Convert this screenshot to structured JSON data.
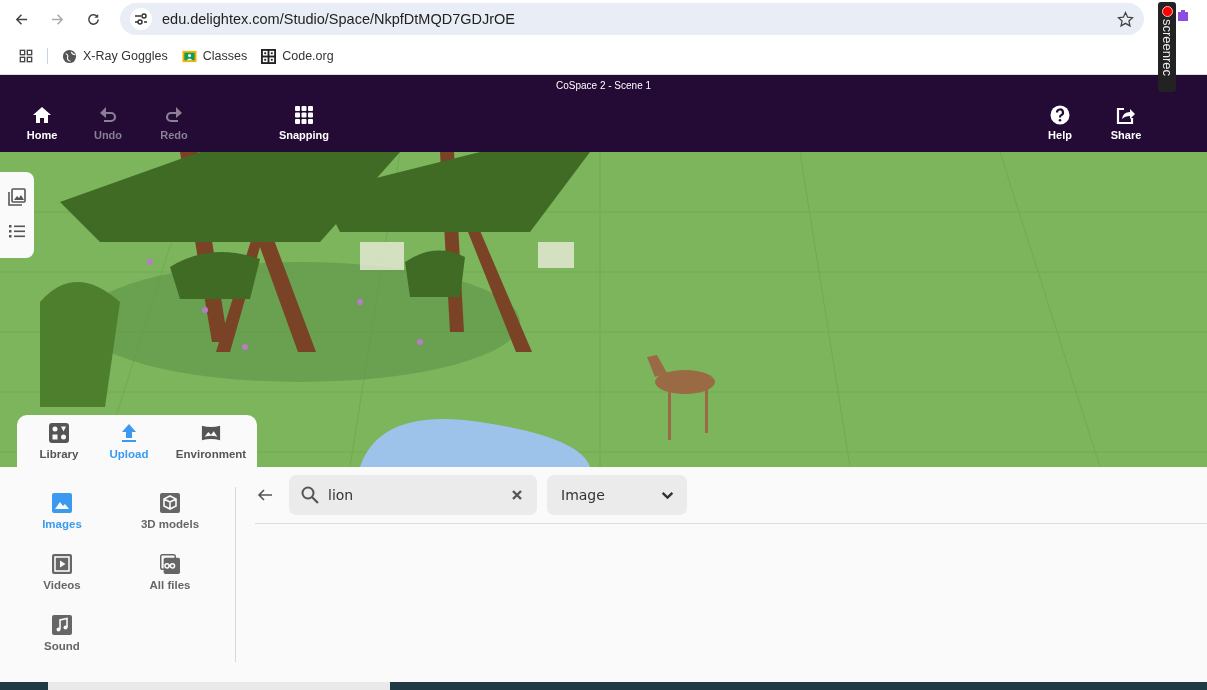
{
  "browser": {
    "url": "edu.delightex.com/Studio/Space/NkpfDtMQD7GDJrOE",
    "bookmarks": [
      {
        "label": "X-Ray Goggles",
        "kind": "globe"
      },
      {
        "label": "Classes",
        "kind": "classroom"
      },
      {
        "label": "Code.org",
        "kind": "code"
      }
    ],
    "recorder": {
      "label": "screenrec"
    }
  },
  "app": {
    "title": "CoSpace 2 - Scene 1",
    "toolbar_left": [
      {
        "label": "Home",
        "kind": "home",
        "disabled": false
      },
      {
        "label": "Undo",
        "kind": "undo",
        "disabled": true
      },
      {
        "label": "Redo",
        "kind": "redo",
        "disabled": true
      },
      {
        "label": "Snapping",
        "kind": "grid",
        "disabled": false
      }
    ],
    "toolbar_right": [
      {
        "label": "Help",
        "kind": "help",
        "disabled": false
      },
      {
        "label": "Share",
        "kind": "share",
        "disabled": false
      }
    ]
  },
  "bottom_panel": {
    "tabs": [
      {
        "label": "Library",
        "kind": "library",
        "selected": false
      },
      {
        "label": "Upload",
        "kind": "upload",
        "selected": true
      },
      {
        "label": "Environment",
        "kind": "environment",
        "selected": false
      }
    ],
    "categories": [
      {
        "label": "Images",
        "kind": "image",
        "selected": true
      },
      {
        "label": "3D models",
        "kind": "cube",
        "selected": false
      },
      {
        "label": "Videos",
        "kind": "video",
        "selected": false
      },
      {
        "label": "All files",
        "kind": "files",
        "selected": false
      },
      {
        "label": "Sound",
        "kind": "sound",
        "selected": false
      }
    ],
    "search": {
      "value": "lion"
    },
    "type_filter": {
      "value": "Image"
    }
  }
}
